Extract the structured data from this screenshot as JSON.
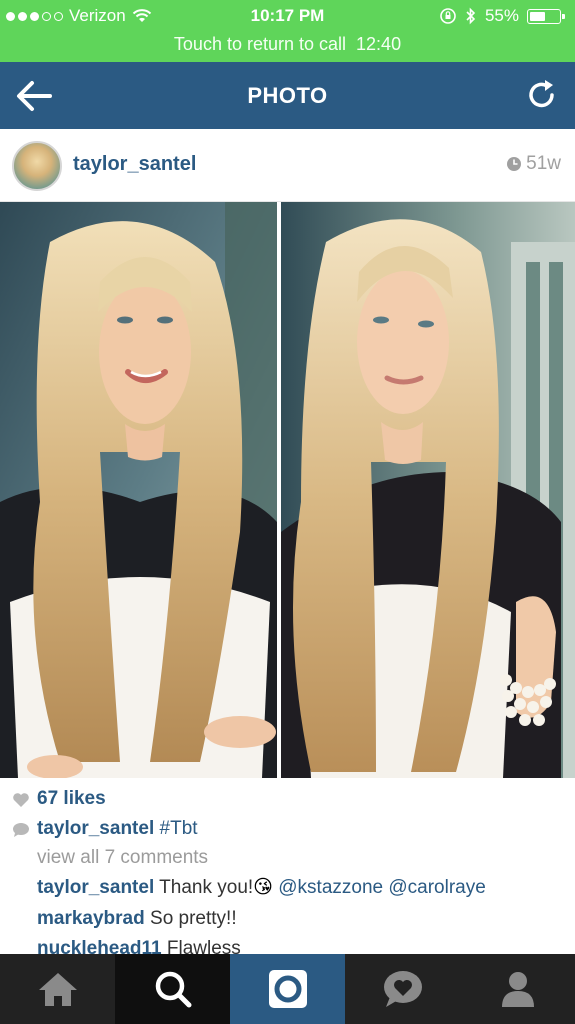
{
  "status_bar": {
    "carrier": "Verizon",
    "time": "10:17 PM",
    "battery": "55%",
    "battery_level": 0.55,
    "call_text": "Touch to return to call",
    "call_timer": "12:40"
  },
  "header": {
    "title": "PHOTO"
  },
  "post": {
    "username": "taylor_santel",
    "age": "51w",
    "likes": "67 likes",
    "caption_user": "taylor_santel",
    "caption_text": "#Tbt",
    "view_comments": "view all 7 comments",
    "comments": [
      {
        "user": "taylor_santel",
        "text": "Thank you!",
        "emoji": "😘",
        "mentions": "@kstazzone @carolraye"
      },
      {
        "user": "markaybrad",
        "text": "So pretty!!"
      },
      {
        "user": "nucklehead11",
        "text": "Flawless"
      }
    ]
  },
  "tab_bar": {
    "tabs": [
      "home",
      "search",
      "camera",
      "activity",
      "profile"
    ]
  },
  "colors": {
    "call_green": "#5fd55a",
    "brand_blue": "#2b5a83",
    "tab_dark": "#222222"
  }
}
